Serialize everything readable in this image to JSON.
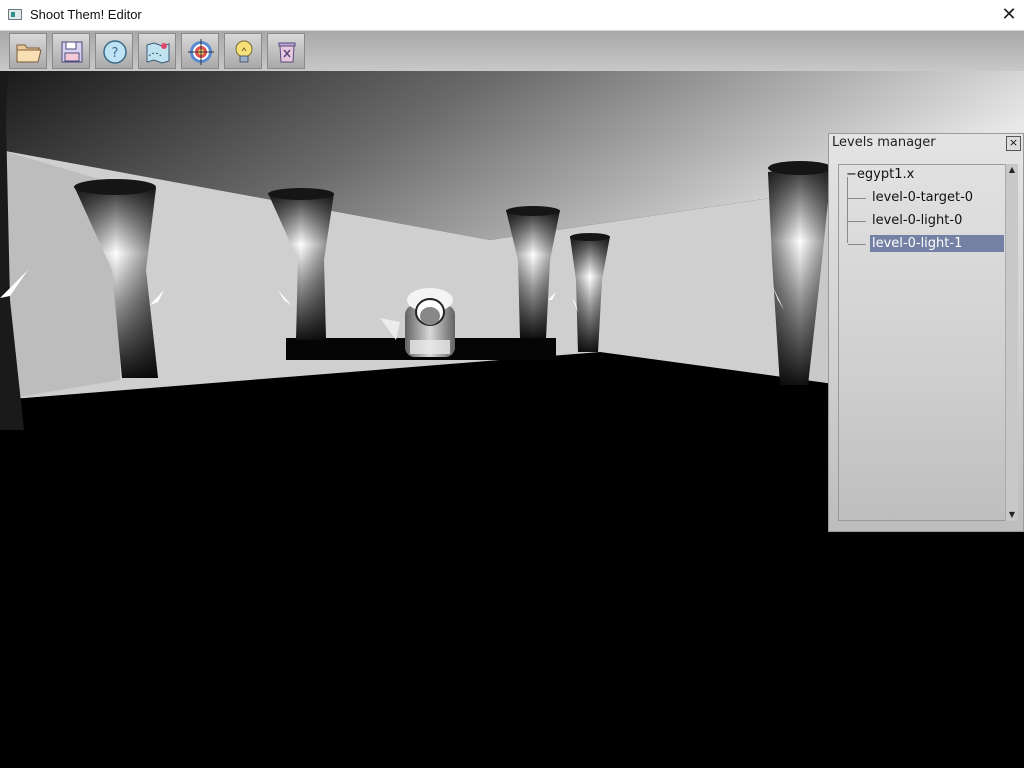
{
  "window": {
    "title": "Shoot Them! Editor"
  },
  "toolbar": {
    "buttons": [
      {
        "name": "open-folder-icon"
      },
      {
        "name": "save-disk-icon"
      },
      {
        "name": "help-icon"
      },
      {
        "name": "map-icon"
      },
      {
        "name": "target-icon"
      },
      {
        "name": "lightbulb-icon"
      },
      {
        "name": "trash-icon"
      }
    ]
  },
  "levels_manager": {
    "title": "Levels manager",
    "close": "×",
    "root": "egypt1.x",
    "items": [
      "level-0-target-0",
      "level-0-light-0",
      "level-0-light-1"
    ],
    "selected_index": 2
  },
  "colors": {
    "selection": "#7480a4"
  }
}
